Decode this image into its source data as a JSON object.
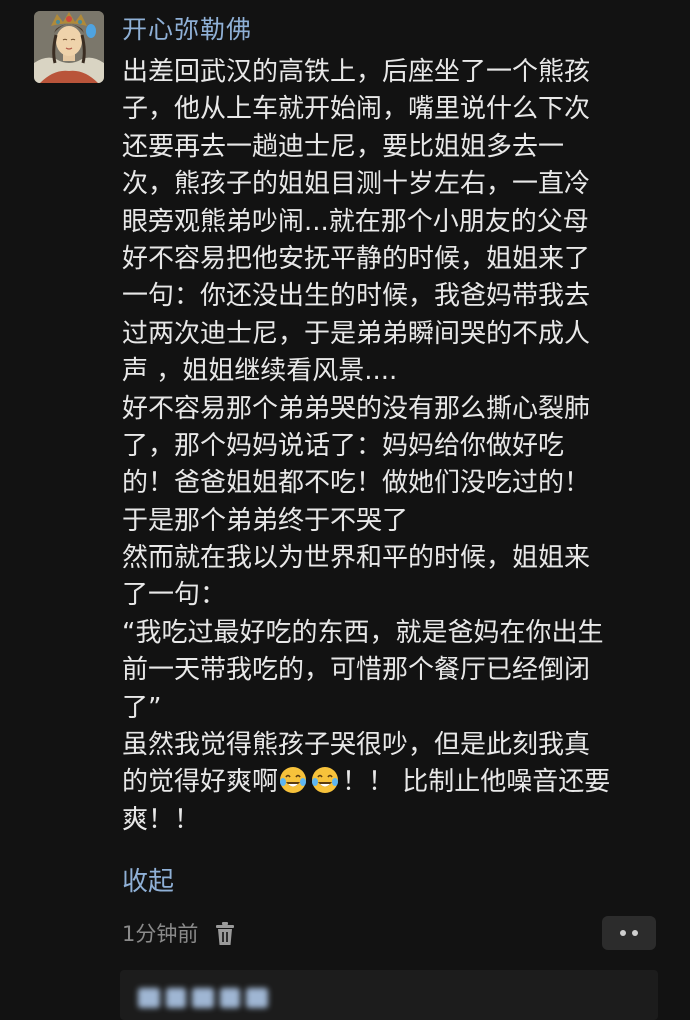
{
  "author": {
    "name": "开心弥勒佛",
    "avatar_icon": "bodhisattva-portrait"
  },
  "post": {
    "lines": [
      "出差回武汉的高铁上，后座坐了一个熊孩",
      "子，他从上车就开始闹，嘴里说什么下次",
      "还要再去一趟迪士尼，要比姐姐多去一",
      "次，熊孩子的姐姐目测十岁左右，一直冷",
      "眼旁观熊弟吵闹...就在那个小朋友的父母",
      "好不容易把他安抚平静的时候，姐姐来了",
      "一句：你还没出生的时候，我爸妈带我去",
      "过两次迪士尼，于是弟弟瞬间哭的不成人",
      "声 ，姐姐继续看风景....",
      "好不容易那个弟弟哭的没有那么撕心裂肺",
      "了，那个妈妈说话了：妈妈给你做好吃",
      "的！爸爸姐姐都不吃！做她们没吃过的！",
      "于是那个弟弟终于不哭了",
      "然而就在我以为世界和平的时候，姐姐来",
      "了一句：",
      "“我吃过最好吃的东西，就是爸妈在你出生",
      "前一天带我吃的，可惜那个餐厅已经倒闭",
      "了”",
      "虽然我觉得熊孩子哭很吵，但是此刻我真"
    ],
    "emoji_line_prefix": "的觉得好爽啊",
    "emoji_icon": "tears-of-joy-emoji",
    "emoji_line_suffix": "！！ 比制止他噪音还要",
    "last_line": "爽！！"
  },
  "actions": {
    "collapse_label": "收起",
    "timestamp": "1分钟前",
    "delete_icon": "trash-icon",
    "more_icon": "more-dots-icon"
  },
  "colors": {
    "background": "#121212",
    "text": "#e8e8e8",
    "link": "#8fb0d6",
    "muted": "#8a8a8a"
  }
}
